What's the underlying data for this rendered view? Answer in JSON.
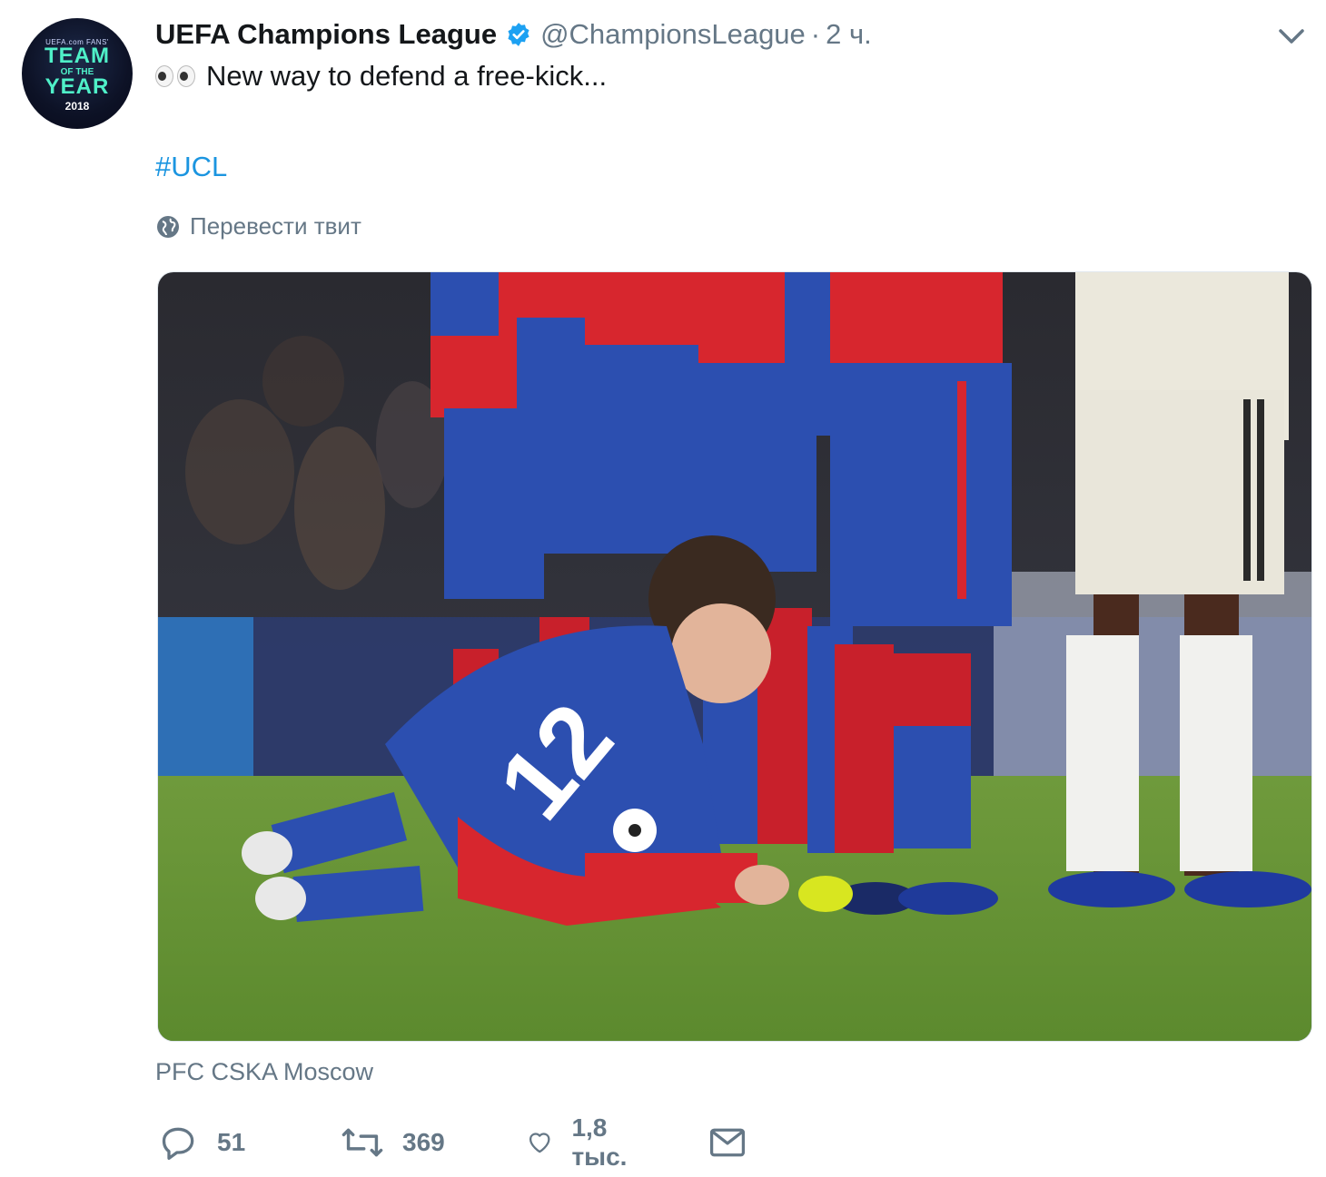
{
  "account": {
    "name": "UEFA Champions League",
    "handle": "@ChampionsLeague",
    "separator": "·",
    "time": "2 ч."
  },
  "avatar": {
    "small_text": "UEFA.com FANS'",
    "line1": "TEAM",
    "line2": "OF THE",
    "line3": "YEAR",
    "year": "2018"
  },
  "tweet": {
    "text": "New way to defend a free-kick...",
    "hashtag": "#UCL",
    "translate_label": "Перевести твит",
    "attribution": "PFC CSKA Moscow"
  },
  "actions": {
    "reply_count": "51",
    "retweet_count": "369",
    "like_count": "1,8 тыс."
  },
  "icons": {
    "verified": "verified-badge-icon",
    "caret": "chevron-down-icon",
    "globe": "globe-icon",
    "reply": "reply-icon",
    "retweet": "retweet-icon",
    "like": "heart-icon",
    "dm": "envelope-icon"
  },
  "colors": {
    "text": "#14171a",
    "secondary": "#657786",
    "link": "#1b95e0",
    "verified": "#1da1f2"
  }
}
